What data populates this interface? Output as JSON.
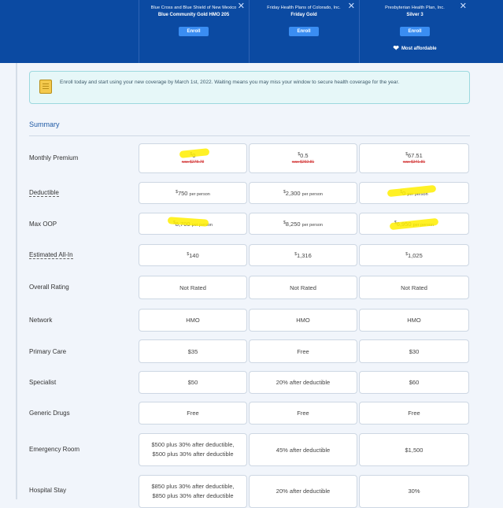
{
  "plans": [
    {
      "carrier": "Blue Cross and Blue Shield of New Mexico",
      "name": "Blue Community Gold HMO 205",
      "enroll": "Enroll",
      "badge": ""
    },
    {
      "carrier": "Friday Health Plans of Colorado, Inc.",
      "name": "Friday Gold",
      "enroll": "Enroll",
      "badge": ""
    },
    {
      "carrier": "Presbyterian Health Plan, Inc.",
      "name": "Silver 3",
      "enroll": "Enroll",
      "badge": "Most affordable"
    }
  ],
  "close_glyph": "✕",
  "alert": {
    "icon": "calendar-icon",
    "text": "Enroll today and start using your new coverage by March 1st, 2022. Waiting means you may miss your window to secure health coverage for the year."
  },
  "summary_title": "Summary",
  "per_person": "per person",
  "currency": "$",
  "rows": {
    "premium": {
      "label": "Monthly Premium",
      "values": [
        {
          "v": "0",
          "old": "was $278.78"
        },
        {
          "v": "0.5",
          "old": "was $292.81"
        },
        {
          "v": "67.51",
          "old": "was $341.81"
        }
      ]
    },
    "deductible": {
      "label": "Deductible",
      "values": [
        "750",
        "2,300",
        "0"
      ]
    },
    "maxoop": {
      "label": "Max OOP",
      "values": [
        "8,700",
        "8,250",
        "6,950"
      ]
    },
    "allin": {
      "label": "Estimated All-In",
      "values": [
        "140",
        "1,316",
        "1,025"
      ]
    },
    "rating": {
      "label": "Overall Rating",
      "values": [
        "Not Rated",
        "Not Rated",
        "Not Rated"
      ]
    },
    "network": {
      "label": "Network",
      "values": [
        "HMO",
        "HMO",
        "HMO"
      ]
    },
    "primary": {
      "label": "Primary Care",
      "values": [
        "$35",
        "Free",
        "$30"
      ]
    },
    "specialist": {
      "label": "Specialist",
      "values": [
        "$50",
        "20% after deductible",
        "$60"
      ]
    },
    "generic": {
      "label": "Generic Drugs",
      "values": [
        "Free",
        "Free",
        "Free"
      ]
    },
    "er": {
      "label": "Emergency Room",
      "values": [
        [
          "$500 plus 30% after deductible,",
          "$500 plus 30% after deductible"
        ],
        [
          "45% after deductible"
        ],
        [
          "$1,500"
        ]
      ]
    },
    "hospital": {
      "label": "Hospital Stay",
      "values": [
        [
          "$850 plus 30% after deductible,",
          "$850 plus 30% after deductible"
        ],
        [
          "20% after deductible"
        ],
        [
          "30%"
        ]
      ]
    }
  },
  "highlight_color": "#ffee00"
}
